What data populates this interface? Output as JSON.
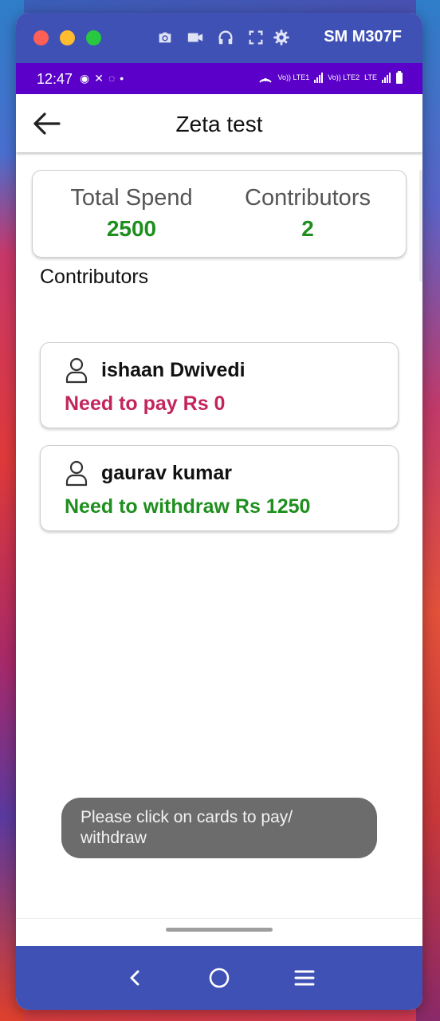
{
  "device": {
    "name": "SM M307F"
  },
  "status_bar": {
    "time": "12:47",
    "network_labels": [
      "Vo)) LTE1",
      "Vo)) LTE2",
      "LTE"
    ]
  },
  "app_bar": {
    "title": "Zeta test"
  },
  "summary": {
    "total_spend_label": "Total Spend",
    "total_spend_value": "2500",
    "contributors_label": "Contributors",
    "contributors_value": "2"
  },
  "section_heading": "Contributors",
  "contributors": [
    {
      "name": "ishaan Dwivedi",
      "status": "Need to pay Rs 0",
      "status_color": "#c2255c"
    },
    {
      "name": "gaurav kumar",
      "status": "Need to withdraw Rs 1250",
      "status_color": "#1e8f1e"
    }
  ],
  "toast": {
    "message": "Please click on cards to pay/ withdraw"
  },
  "colors": {
    "primary": "#3f51b5",
    "status_bar": "#5a00c8",
    "accent_green": "#1e8f1e",
    "accent_pink": "#c2255c"
  },
  "icons": {
    "titlebar": [
      "camera-icon",
      "video-icon",
      "headphones-icon",
      "fullscreen-icon",
      "settings-gear-icon"
    ],
    "navbar": [
      "nav-back-icon",
      "nav-home-icon",
      "nav-recents-icon"
    ]
  }
}
